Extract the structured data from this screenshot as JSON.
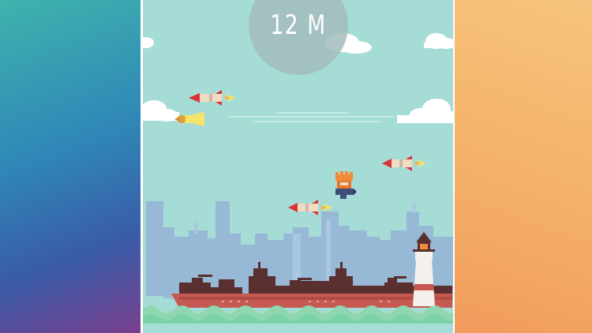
{
  "hud": {
    "distance_label": "12 M"
  },
  "colors": {
    "sky": "#a6dcd6",
    "cloud": "#ffffff",
    "city": "#97b9d6",
    "ship": "#c65a52",
    "ship_dark": "#5a2f2f",
    "water": "#7ad1a7",
    "rocket_body": "#f2dcc2",
    "rocket_tip": "#d9343a",
    "flame": "#f5e56b",
    "player_hair": "#e8762a",
    "player_body": "#3c4f7a"
  },
  "sprites": {
    "rockets": [
      "rocket-icon",
      "rocket-icon",
      "rocket-icon",
      "rocket-icon",
      "bomb-icon"
    ],
    "player": "jetpack-hero-icon",
    "lighthouse": "lighthouse-icon",
    "warships": "warship-icon"
  }
}
